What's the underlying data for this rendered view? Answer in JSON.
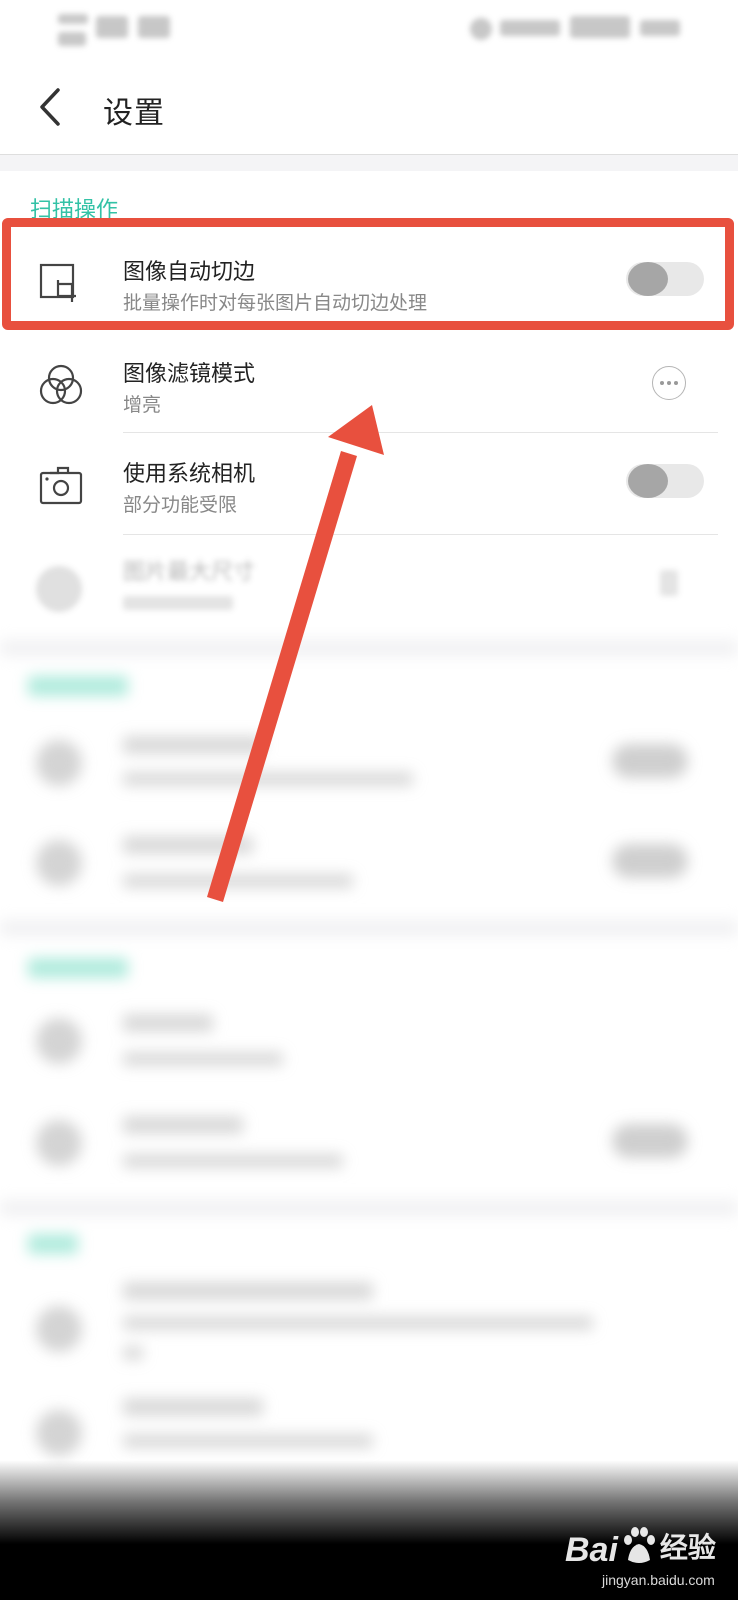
{
  "app_bar": {
    "title": "设置"
  },
  "section": {
    "header": "扫描操作"
  },
  "settings": [
    {
      "title": "图像自动切边",
      "subtitle": "批量操作时对每张图片自动切边处理",
      "control": "toggle",
      "on": false
    },
    {
      "title": "图像滤镜模式",
      "subtitle": "增亮",
      "control": "more"
    },
    {
      "title": "使用系统相机",
      "subtitle": "部分功能受限",
      "control": "toggle",
      "on": false
    },
    {
      "title": "图片最大尺寸",
      "subtitle": "",
      "control": "chevron"
    }
  ],
  "colors": {
    "accent": "#33c2a6",
    "highlight": "#e8503e",
    "toggle_off_knob": "#a6a6a6"
  },
  "watermark": {
    "logo_text": "Bai",
    "logo_suffix": "经验",
    "url": "jingyan.baidu.com"
  }
}
